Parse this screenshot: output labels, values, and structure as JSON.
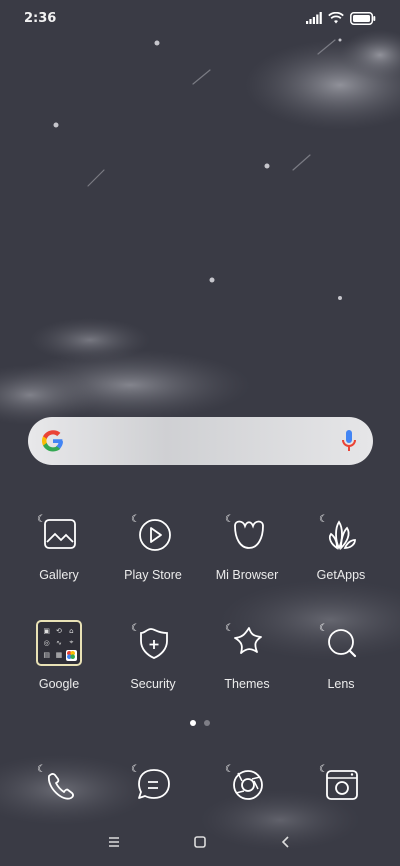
{
  "status": {
    "time": "2:36"
  },
  "search": {
    "engine": "Google",
    "mic": "mic-icon"
  },
  "apps_row1": [
    {
      "label": "Gallery",
      "icon": "gallery-icon"
    },
    {
      "label": "Play Store",
      "icon": "play-icon"
    },
    {
      "label": "Mi Browser",
      "icon": "browser-icon"
    },
    {
      "label": "GetApps",
      "icon": "getapps-icon"
    }
  ],
  "apps_row2": [
    {
      "label": "Google",
      "icon": "folder-icon"
    },
    {
      "label": "Security",
      "icon": "security-icon"
    },
    {
      "label": "Themes",
      "icon": "themes-icon"
    },
    {
      "label": "Lens",
      "icon": "lens-icon"
    }
  ],
  "dock": [
    {
      "icon": "phone-icon"
    },
    {
      "icon": "messages-icon"
    },
    {
      "icon": "camera-shutter-icon"
    },
    {
      "icon": "camera-icon"
    }
  ],
  "pager": {
    "pages": 2,
    "active": 1
  },
  "colors": {
    "background": "#3a3b45",
    "icon_stroke": "#ffffff",
    "folder_border": "#e9e2b6"
  }
}
